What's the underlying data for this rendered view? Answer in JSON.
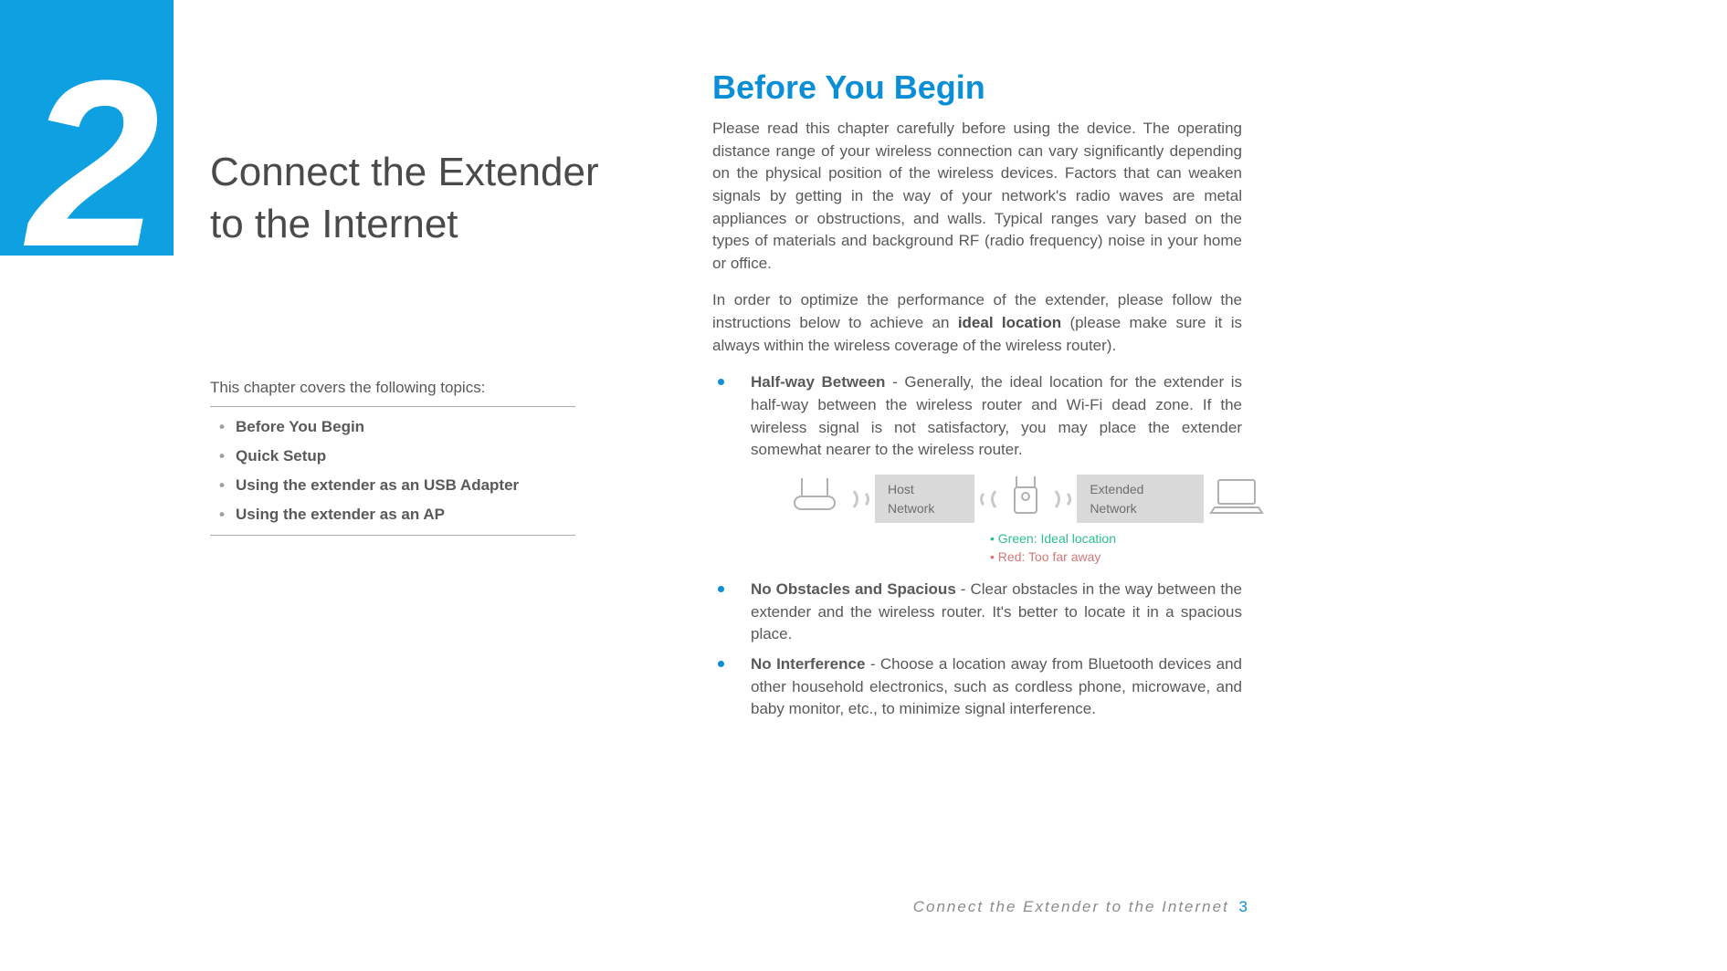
{
  "chapter": {
    "number": "2",
    "title_line1": "Connect the Extender",
    "title_line2": "to the Internet"
  },
  "topics": {
    "intro": "This chapter covers the following topics:",
    "items": [
      "Before You Begin",
      "Quick Setup",
      "Using the extender as an USB Adapter",
      "Using the extender as an AP"
    ]
  },
  "section": {
    "heading": "Before You Begin",
    "para1": "Please read this chapter carefully before using the device. The operating distance range of your wireless connection can vary significantly depending on the physical position of the wireless devices. Factors that can weaken signals by getting in the way of your network's radio waves are metal appliances or obstructions, and walls. Typical ranges vary based on the types of materials and background RF (radio frequency) noise in your home or office.",
    "para2_pre": "In order to optimize the performance of the extender, please follow the instructions below to achieve an ",
    "para2_bold": "ideal location",
    "para2_post": " (please make sure it is always within the wireless coverage of the wireless router).",
    "bullets": [
      {
        "title": "Half-way Between",
        "text": " - Generally, the ideal location for the extender is half-way between the wireless router and Wi-Fi dead zone. If the wireless signal is not satisfactory, you may place the extender somewhat nearer to the wireless router."
      },
      {
        "title": "No Obstacles and Spacious",
        "text": " - Clear obstacles in the way between the extender and the wireless router. It's better to locate it in a spacious place."
      },
      {
        "title": "No Interference",
        "text": " - Choose a location away from Bluetooth devices and other household electronics, such as cordless phone, microwave, and baby monitor, etc., to minimize signal interference."
      }
    ]
  },
  "diagram": {
    "host_label": "Host Network",
    "ext_label": "Extended Network",
    "legend_green": "Green: Ideal location",
    "legend_red": "Red: Too far away"
  },
  "footer": {
    "text": "Connect the Extender to the Internet",
    "page": "3"
  }
}
